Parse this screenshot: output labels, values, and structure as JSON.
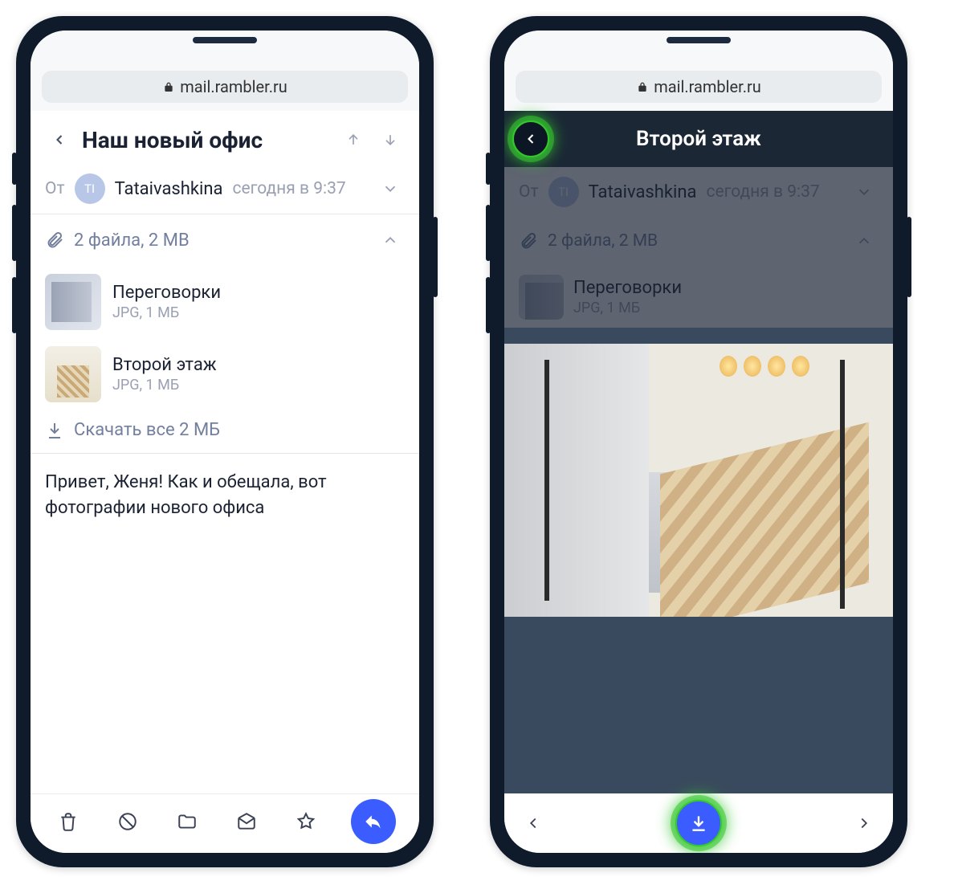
{
  "urlbar": {
    "host": "mail.rambler.ru"
  },
  "left": {
    "subject": "Наш новый офис",
    "from_label": "От",
    "avatar_initials": "TI",
    "sender_name": "Tataivashkina",
    "sender_time": "сегодня в 9:37",
    "attachments_summary": "2 файла, 2 MB",
    "attachments": [
      {
        "name": "Переговорки",
        "meta": "JPG, 1 МБ"
      },
      {
        "name": "Второй этаж",
        "meta": "JPG, 1 МБ"
      }
    ],
    "download_all": "Скачать все 2 МБ",
    "body": "Привет, Женя! Как и обещала, вот фотографии нового офиса"
  },
  "right": {
    "viewer_title": "Второй этаж",
    "behind": {
      "from_label": "От",
      "avatar_initials": "TI",
      "sender_name": "Tataivashkina",
      "sender_time": "сегодня в 9:37",
      "attachments_summary": "2 файла, 2 MB",
      "file_name": "Переговорки",
      "file_meta": "JPG, 1 МБ"
    }
  }
}
